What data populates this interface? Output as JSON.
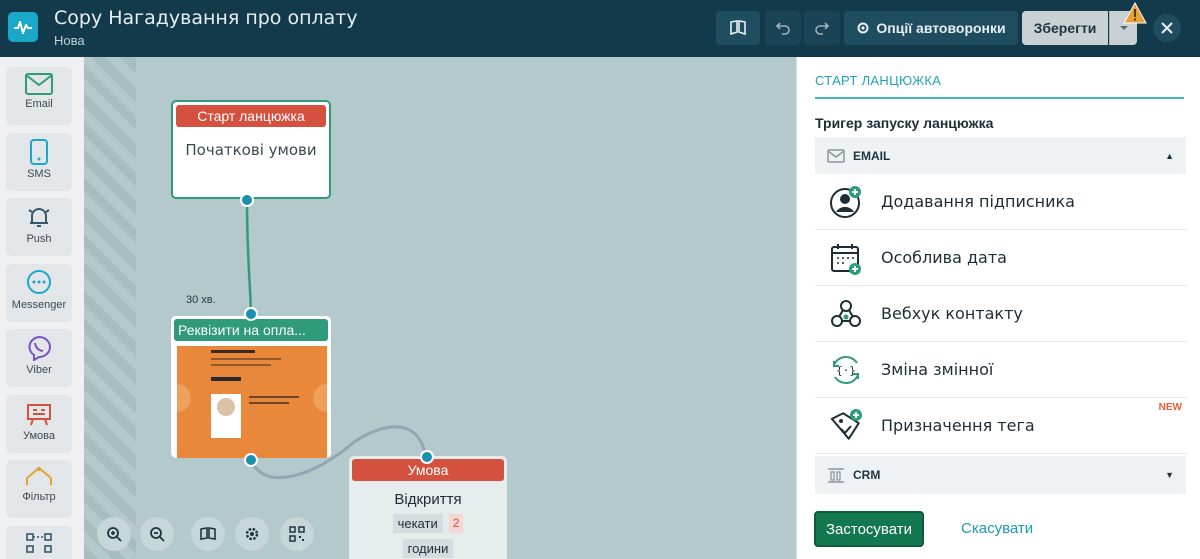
{
  "header": {
    "title": "Copy Нагадування про оплату",
    "status": "Нова",
    "options_label": "Опції автоворонки",
    "save_label": "Зберегти"
  },
  "palette": [
    {
      "label": "Email",
      "icon": "mail-icon"
    },
    {
      "label": "SMS",
      "icon": "phone-icon"
    },
    {
      "label": "Push",
      "icon": "bell-icon"
    },
    {
      "label": "Messenger",
      "icon": "chat-icon"
    },
    {
      "label": "Viber",
      "icon": "viber-icon"
    },
    {
      "label": "Умова",
      "icon": "condition-icon"
    },
    {
      "label": "Фільтр",
      "icon": "filter-icon"
    }
  ],
  "canvas": {
    "start_node": {
      "title": "Старт ланцюжка",
      "body": "Початкові умови"
    },
    "delay_label": "30 хв.",
    "email_node": {
      "title": "Реквізити на опла..."
    },
    "condition_node": {
      "title": "Умова",
      "body": "Відкриття",
      "wait_label": "чекати",
      "wait_value": "2",
      "unit": "години"
    }
  },
  "panel": {
    "title": "СТАРТ ЛАНЦЮЖКА",
    "trigger_label": "Тригер запуску ланцюжка",
    "group_email": "EMAIL",
    "options": [
      {
        "label": "Додавання підписника",
        "icon": "add-subscriber-icon",
        "badge": ""
      },
      {
        "label": "Особлива дата",
        "icon": "calendar-icon",
        "badge": ""
      },
      {
        "label": "Вебхук контакту",
        "icon": "webhook-icon",
        "badge": ""
      },
      {
        "label": "Зміна змінної",
        "icon": "variable-icon",
        "badge": ""
      },
      {
        "label": "Призначення тега",
        "icon": "tag-icon",
        "badge": "NEW"
      }
    ],
    "group_crm": "CRM",
    "apply_label": "Застосувати",
    "cancel_label": "Скасувати"
  }
}
